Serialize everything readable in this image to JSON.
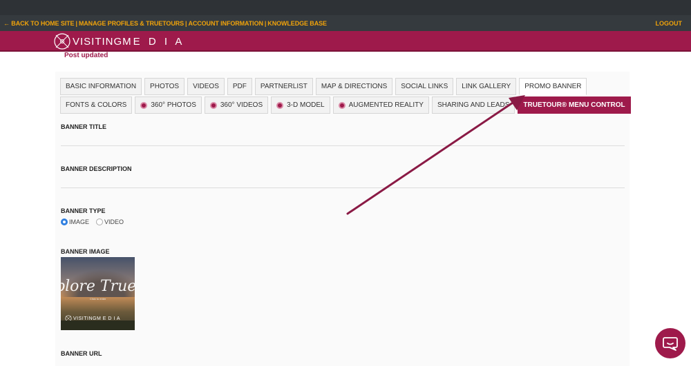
{
  "nav": {
    "links": [
      "← BACK TO HOME SITE",
      "MANAGE PROFILES & TRUETOURS",
      "ACCOUNT INFORMATION",
      "KNOWLEDGE BASE"
    ],
    "separator": "|",
    "logout": "LOGOUT"
  },
  "brand": {
    "word_bold": "VISITINGM",
    "word_thin": "E D I A"
  },
  "notice": "Post updated",
  "tabs": {
    "row1": [
      {
        "label": "BASIC INFORMATION"
      },
      {
        "label": "PHOTOS"
      },
      {
        "label": "VIDEOS"
      },
      {
        "label": "PDF"
      },
      {
        "label": "PARTNERLIST"
      },
      {
        "label": "MAP & DIRECTIONS"
      },
      {
        "label": "SOCIAL LINKS"
      },
      {
        "label": "LINK GALLERY"
      },
      {
        "label": "PROMO BANNER"
      }
    ],
    "row2": [
      {
        "label": "FONTS & COLORS"
      },
      {
        "label": "360° PHOTOS"
      },
      {
        "label": "360° VIDEOS"
      },
      {
        "label": "3-D MODEL"
      },
      {
        "label": "AUGMENTED REALITY"
      },
      {
        "label": "SHARING AND LEADS"
      },
      {
        "label": "TRUETOUR® MENU CONTROL"
      }
    ]
  },
  "form": {
    "banner_title_label": "BANNER TITLE",
    "banner_description_label": "BANNER DESCRIPTION",
    "banner_type_label": "BANNER TYPE",
    "banner_type_options": [
      "IMAGE",
      "VIDEO"
    ],
    "banner_type_selected": "IMAGE",
    "banner_image_label": "BANNER IMAGE",
    "banner_url_label": "BANNER URL"
  },
  "banner_image": {
    "script_text": "plore TrueTo",
    "sub_text": "Click to enter",
    "brand_text": "VISITINGM E D I A"
  },
  "colors": {
    "brand": "#9e1a4b",
    "nav_bg": "#353a3e",
    "nav_link": "#f0a30a",
    "radio_selected": "#2f7fe0"
  }
}
